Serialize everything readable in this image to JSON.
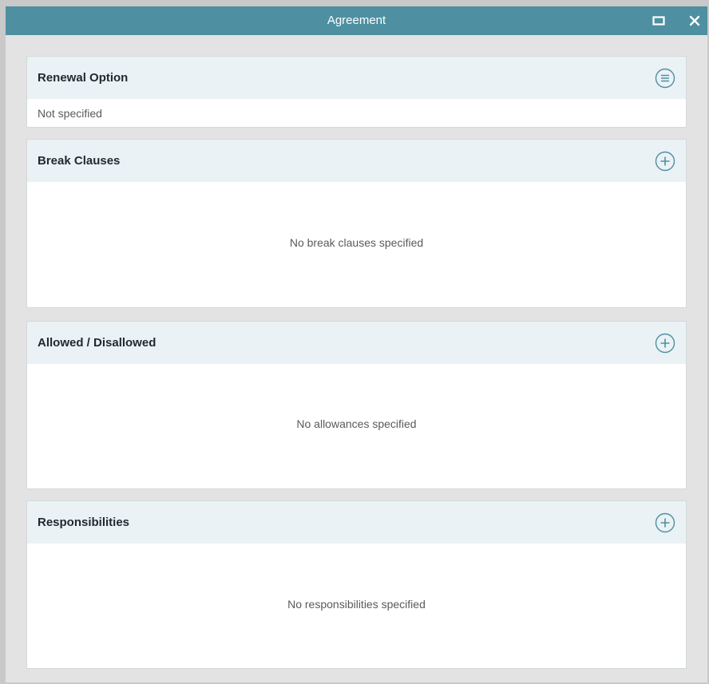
{
  "window": {
    "title": "Agreement",
    "maximize_icon": "maximize-icon",
    "close_icon": "close-icon",
    "accent_color": "#4e8fa1"
  },
  "panels": [
    {
      "title": "Renewal Option",
      "action_icon": "list-menu-icon",
      "value": "Not specified"
    },
    {
      "title": "Break Clauses",
      "action_icon": "add-circle-icon",
      "empty_message": "No break clauses specified"
    },
    {
      "title": "Allowed / Disallowed",
      "action_icon": "add-circle-icon",
      "empty_message": "No allowances specified"
    },
    {
      "title": "Responsibilities",
      "action_icon": "add-circle-icon",
      "empty_message": "No responsibilities specified"
    }
  ]
}
